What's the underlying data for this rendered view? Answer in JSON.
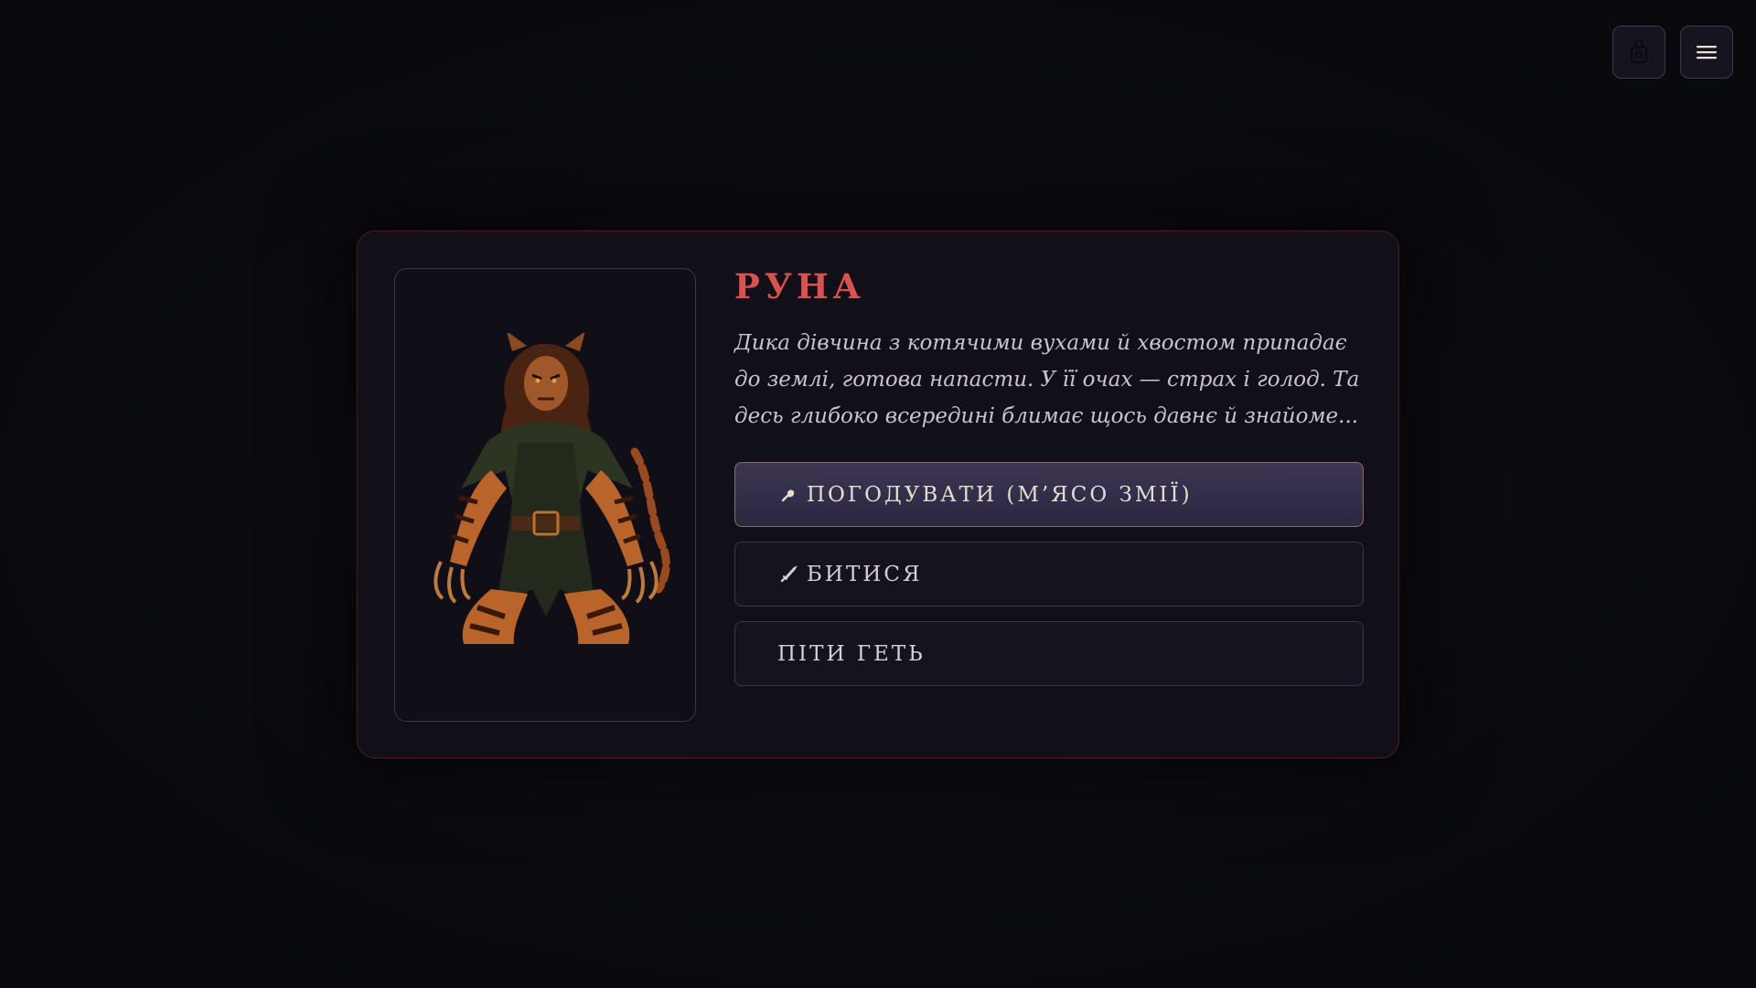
{
  "toolbar": {
    "inventory_icon": "bag-icon",
    "menu_icon": "hamburger-menu-icon"
  },
  "encounter": {
    "name": "РУНА",
    "description": "Дика дівчина з котячими вухами й хвостом припадає до землі, готова напасти. У її очах — страх і голод. Та десь глибоко всередині блимає щось давнє й знайоме...",
    "portrait": "tiger-cat-girl-illustration",
    "choices": [
      {
        "label": "ПОГОДУВАТИ (М’ЯСО ЗМІЇ)",
        "icon": "meat-icon",
        "highlighted": true
      },
      {
        "label": "БИТИСЯ",
        "icon": "dagger-icon",
        "highlighted": false
      },
      {
        "label": "ПІТИ ГЕТЬ",
        "icon": "",
        "highlighted": false
      }
    ]
  },
  "colors": {
    "accent": "#d9524f",
    "background": "#0b0b10",
    "card": "#110f18",
    "highlight_border": "#8b6f4e"
  }
}
